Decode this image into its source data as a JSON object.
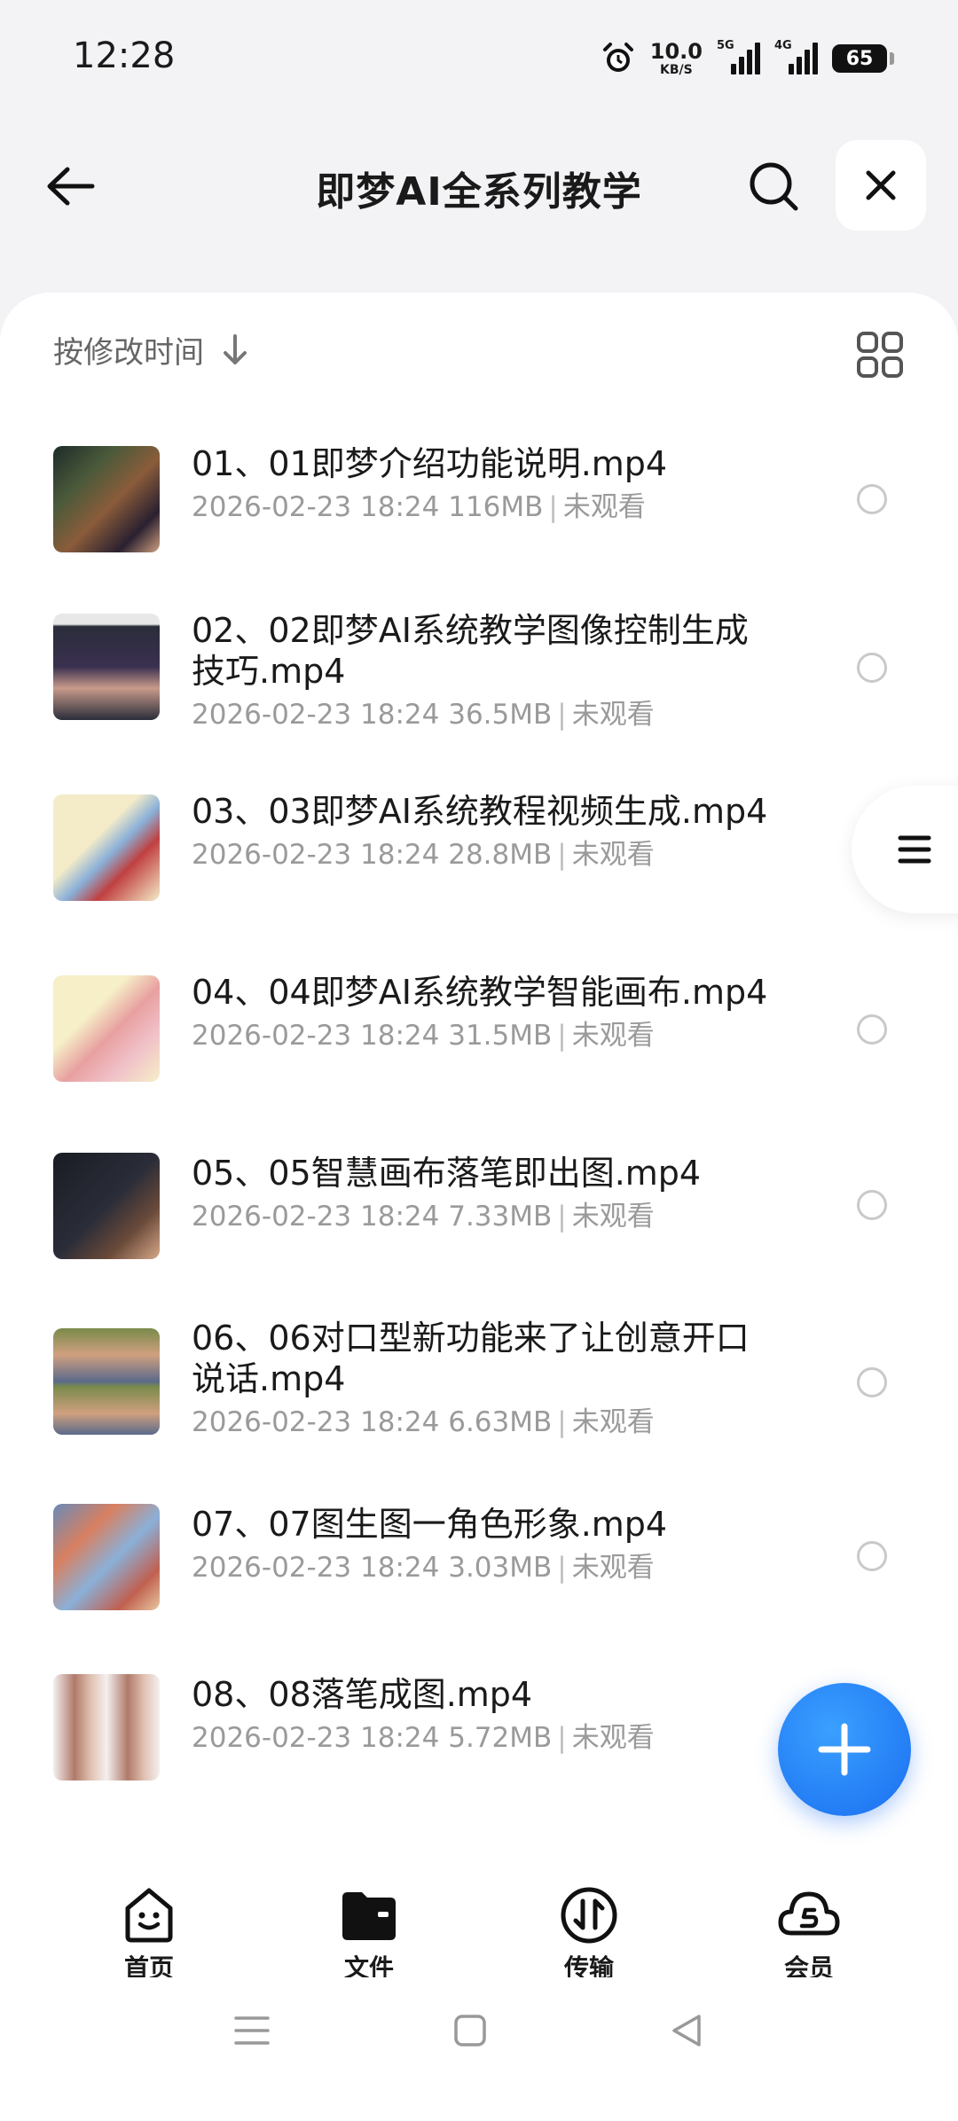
{
  "status": {
    "time": "12:28",
    "net_speed_value": "10.0",
    "net_speed_unit": "KB/S",
    "sim1_label": "5G",
    "sim2_label": "4G",
    "battery": "65",
    "icons": [
      "alarm-icon",
      "signal-icon",
      "battery-icon"
    ]
  },
  "header": {
    "title": "即梦AI全系列教学"
  },
  "sort": {
    "label": "按修改时间"
  },
  "files": [
    {
      "name": "01、01即梦介绍功能说明.mp4",
      "date": "2026-02-23 18:24",
      "size": "116MB",
      "status": "未观看"
    },
    {
      "name": "02、02即梦AI系统教学图像控制生成技巧.mp4",
      "date": "2026-02-23 18:24",
      "size": "36.5MB",
      "status": "未观看"
    },
    {
      "name": "03、03即梦AI系统教程视频生成.mp4",
      "date": "2026-02-23 18:24",
      "size": "28.8MB",
      "status": "未观看"
    },
    {
      "name": "04、04即梦AI系统教学智能画布.mp4",
      "date": "2026-02-23 18:24",
      "size": "31.5MB",
      "status": "未观看"
    },
    {
      "name": "05、05智慧画布落笔即出图.mp4",
      "date": "2026-02-23 18:24",
      "size": "7.33MB",
      "status": "未观看"
    },
    {
      "name": "06、06对口型新功能来了让创意开口说话.mp4",
      "date": "2026-02-23 18:24",
      "size": "6.63MB",
      "status": "未观看"
    },
    {
      "name": "07、07图生图一角色形象.mp4",
      "date": "2026-02-23 18:24",
      "size": "3.03MB",
      "status": "未观看"
    },
    {
      "name": "08、08落笔成图.mp4",
      "date": "2026-02-23 18:24",
      "size": "5.72MB",
      "status": "未观看"
    }
  ],
  "nav": {
    "home": "首页",
    "files": "文件",
    "transfer": "传输",
    "vip": "会员"
  },
  "colors": {
    "accent": "#1a6ef0",
    "background": "#f3f3f5",
    "panel": "#ffffff"
  }
}
